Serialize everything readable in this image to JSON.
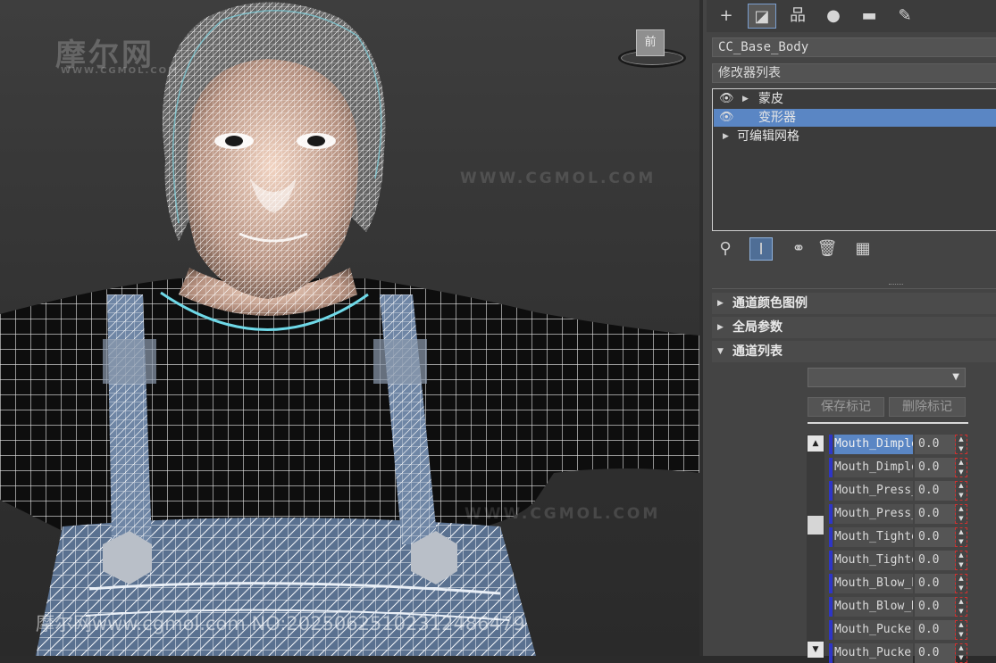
{
  "viewport": {
    "watermark_logo": "摩尔网",
    "watermark_logo_sub": "WWW.CGMOL.COM",
    "watermark_url": "WWW.CGMOL.COM",
    "bottom_watermark": "摩尔网www.cgmol.com NO:20250625102312486479",
    "viewcube_label": "前"
  },
  "tabs": [
    {
      "icon": "plus-icon",
      "glyph": "+"
    },
    {
      "icon": "modify-icon",
      "glyph": "◪"
    },
    {
      "icon": "hierarchy-icon",
      "glyph": "品"
    },
    {
      "icon": "motion-icon",
      "glyph": "●"
    },
    {
      "icon": "display-icon",
      "glyph": "▬"
    },
    {
      "icon": "utilities-icon",
      "glyph": "✎"
    }
  ],
  "object_name": "CC_Base_Body",
  "modifier_list_label": "修改器列表",
  "modifier_stack": [
    {
      "label": "蒙皮",
      "eye": true,
      "expandable": true,
      "selected": false
    },
    {
      "label": "变形器",
      "eye": true,
      "expandable": false,
      "selected": true
    },
    {
      "label": "可编辑网格",
      "eye": false,
      "expandable": true,
      "selected": false
    }
  ],
  "stack_tools": [
    {
      "icon": "pin-stack-icon",
      "glyph": "⚲"
    },
    {
      "icon": "show-end-result-icon",
      "glyph": "I"
    },
    {
      "icon": "make-unique-icon",
      "glyph": "⚭"
    },
    {
      "icon": "remove-modifier-icon",
      "glyph": "🗑"
    },
    {
      "icon": "configure-sets-icon",
      "glyph": "▦"
    }
  ],
  "rollouts": [
    {
      "label": "通道颜色图例",
      "expanded": false
    },
    {
      "label": "全局参数",
      "expanded": false
    },
    {
      "label": "通道列表",
      "expanded": true
    }
  ],
  "channel_list": {
    "save_marker_label": "保存标记",
    "delete_marker_label": "删除标记",
    "channels": [
      {
        "name": "Mouth_Dimple_L",
        "value": "0.0",
        "selected": true
      },
      {
        "name": "Mouth_Dimple_R",
        "value": "0.0",
        "selected": false
      },
      {
        "name": "Mouth_Press_L",
        "value": "0.0",
        "selected": false
      },
      {
        "name": "Mouth_Press_R",
        "value": "0.0",
        "selected": false
      },
      {
        "name": "Mouth_Tighten_L",
        "value": "0.0",
        "selected": false
      },
      {
        "name": "Mouth_Tighten_R",
        "value": "0.0",
        "selected": false
      },
      {
        "name": "Mouth_Blow_L",
        "value": "0.0",
        "selected": false
      },
      {
        "name": "Mouth_Blow_R",
        "value": "0.0",
        "selected": false
      },
      {
        "name": "Mouth_Pucker_L",
        "value": "0.0",
        "selected": false
      },
      {
        "name": "Mouth_Pucker_R",
        "value": "0.0",
        "selected": false
      }
    ]
  },
  "colors": {
    "selection_blue": "#5a86c4",
    "channel_marker": "#2e35c8",
    "wireframe": "#ffffff",
    "neck_highlight": "#6fd9e8"
  }
}
